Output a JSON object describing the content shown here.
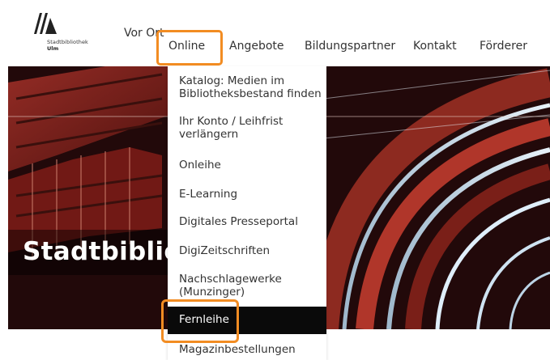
{
  "logo": {
    "name": "Stadtbibliothek",
    "city": "Ulm"
  },
  "nav": {
    "vor_ort": "Vor Ort",
    "online": "Online",
    "angebote": "Angebote",
    "bildungspartner": "Bildungspartner",
    "kontakt": "Kontakt",
    "foerderer": "Förderer"
  },
  "hero": {
    "title": "Stadtbibliot"
  },
  "dropdown": {
    "items": [
      {
        "label": "Katalog: Medien im Bibliotheksbestand finden"
      },
      {
        "label": "Ihr Konto / Leihfrist verlängern"
      },
      {
        "label": "Onleihe"
      },
      {
        "label": "E-Learning"
      },
      {
        "label": "Digitales Presseportal"
      },
      {
        "label": "DigiZeitschriften"
      },
      {
        "label": "Nachschlagewerke (Munzinger)"
      },
      {
        "label": "Fernleihe"
      },
      {
        "label": "Magazinbestellungen"
      }
    ]
  },
  "colors": {
    "highlight": "#f28c22",
    "active_bg": "#0a0a0a"
  }
}
